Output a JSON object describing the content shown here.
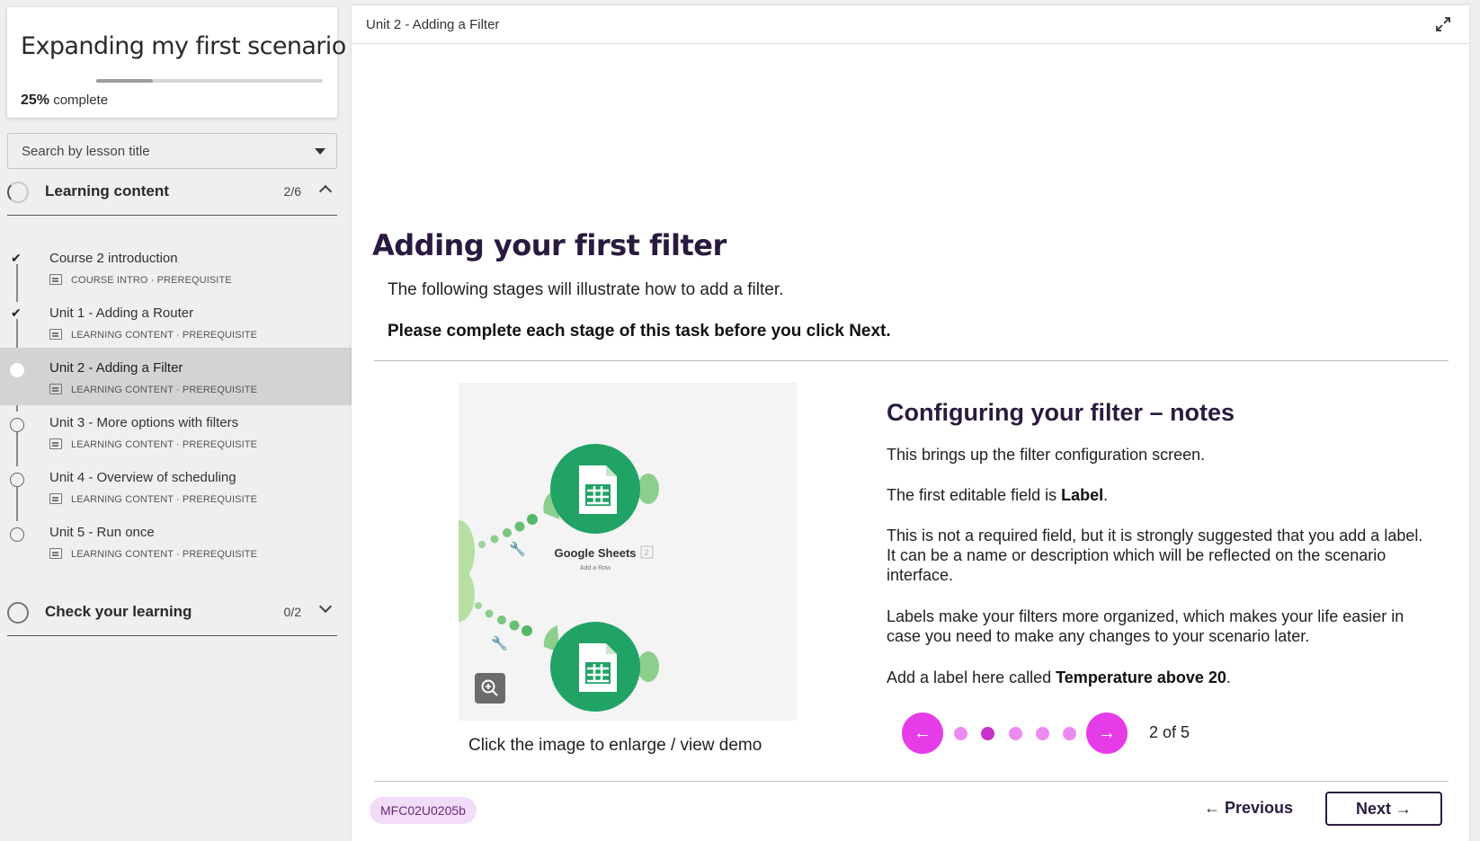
{
  "sidebar": {
    "course_title": "Expanding my first scenario",
    "progress_percent": 25,
    "progress_pct_label": "25%",
    "progress_suffix": "complete",
    "search_placeholder": "Search by lesson title",
    "sections": [
      {
        "title": "Learning content",
        "count": "2/6",
        "expanded": true,
        "lessons": [
          {
            "title": "Course 2 introduction",
            "meta": "COURSE INTRO · PREREQUISITE",
            "status": "completed"
          },
          {
            "title": "Unit 1 - Adding a Router",
            "meta": "LEARNING CONTENT · PREREQUISITE",
            "status": "completed"
          },
          {
            "title": "Unit 2 - Adding a Filter",
            "meta": "LEARNING CONTENT · PREREQUISITE",
            "status": "current"
          },
          {
            "title": "Unit 3 - More options with filters",
            "meta": "LEARNING CONTENT · PREREQUISITE",
            "status": "not-started"
          },
          {
            "title": "Unit 4 - Overview of scheduling",
            "meta": "LEARNING CONTENT · PREREQUISITE",
            "status": "not-started"
          },
          {
            "title": "Unit 5 - Run once",
            "meta": "LEARNING CONTENT · PREREQUISITE",
            "status": "not-started"
          }
        ]
      },
      {
        "title": "Check your learning",
        "count": "0/2",
        "expanded": false
      }
    ]
  },
  "main": {
    "header_title": "Unit 2 - Adding a Filter",
    "heading": "Adding your first filter",
    "intro": "The following stages will illustrate how to add a filter.",
    "intro_bold": "Please complete each stage of this task before you click Next.",
    "image": {
      "module_label": "Google Sheets",
      "module_badge": "2",
      "module_sub": "Add a Row",
      "caption": "Click the image to enlarge / view demo"
    },
    "notes": {
      "title": "Configuring your filter – notes",
      "p1": "This brings up the filter configuration screen.",
      "p2_prefix": "The first editable field is ",
      "p2_bold": "Label",
      "p2_suffix": ".",
      "p3": "This is not a required field, but it is strongly suggested that you add a label. It can be a name or description which will be reflected on the scenario interface.",
      "p4": "Labels make your filters more organized, which makes your life easier in case you need to make any changes to your scenario later.",
      "p5_prefix": "Add a label here called ",
      "p5_bold": "Temperature above 20",
      "p5_suffix": "."
    },
    "carousel": {
      "current": 2,
      "total": 5,
      "label": "2 of 5",
      "prev_icon": "←",
      "next_icon": "→"
    },
    "footer": {
      "code": "MFC02U0205b",
      "previous_label": "Previous",
      "next_label": "Next",
      "previous_icon": "←",
      "next_icon": "→"
    }
  },
  "colors": {
    "accent": "#e63ce8",
    "heading": "#2b1a3f",
    "sheets_green": "#21a366"
  }
}
